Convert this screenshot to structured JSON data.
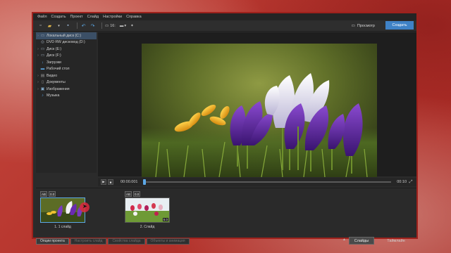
{
  "menu": [
    "Файл",
    "Создать",
    "Проект",
    "Слайд",
    "Настройки",
    "Справка"
  ],
  "toolbar": {
    "ratio_label": "16:",
    "monitor_caret": "▾",
    "star": "✦",
    "preview_label": "Просмотр",
    "create_label": "Создать"
  },
  "sidebar": {
    "items": [
      {
        "label": "Локальный диск (C:)",
        "icon": "drive-icon",
        "expand": true,
        "active": true
      },
      {
        "label": "DVD RW дисковод (D:)",
        "icon": "dvd-icon",
        "expand": false,
        "active": false
      },
      {
        "label": "Диск (E:)",
        "icon": "drive-icon",
        "expand": true,
        "active": false
      },
      {
        "label": "Диск (F:)",
        "icon": "drive-icon",
        "expand": true,
        "active": false
      },
      {
        "label": "Загрузки",
        "icon": "download-icon",
        "expand": false,
        "active": false
      },
      {
        "label": "Рабочий стол",
        "icon": "desktop-icon",
        "expand": false,
        "active": false
      },
      {
        "label": "Видео",
        "icon": "video-icon",
        "expand": true,
        "active": false
      },
      {
        "label": "Документы",
        "icon": "document-icon",
        "expand": true,
        "active": false
      },
      {
        "label": "Изображения",
        "icon": "image-icon",
        "expand": true,
        "active": false
      },
      {
        "label": "Музыка",
        "icon": "music-icon",
        "expand": false,
        "active": false
      }
    ]
  },
  "player": {
    "time_current": "00:00.001",
    "time_total": "00:10",
    "progress": 0.0
  },
  "slides": [
    {
      "ab": "AB",
      "badge": "0.0",
      "label": "1. 1 слайд",
      "duration": "",
      "selected": true
    },
    {
      "ab": "AB",
      "badge": "0.0",
      "label": "2. Слайд",
      "duration": "5.0",
      "selected": false
    }
  ],
  "bottom_buttons": [
    {
      "label": "Опции проекта",
      "enabled": true
    },
    {
      "label": "Настроить слайд",
      "enabled": false
    },
    {
      "label": "Свойства слайда",
      "enabled": false
    },
    {
      "label": "Объекты и анимация",
      "enabled": false
    }
  ],
  "view_tabs": {
    "slides": "Слайды",
    "timeline": "Таймлайн"
  },
  "colors": {
    "accent": "#3f82c6",
    "frame": "#9e211c",
    "panel": "#2b2b2b"
  }
}
